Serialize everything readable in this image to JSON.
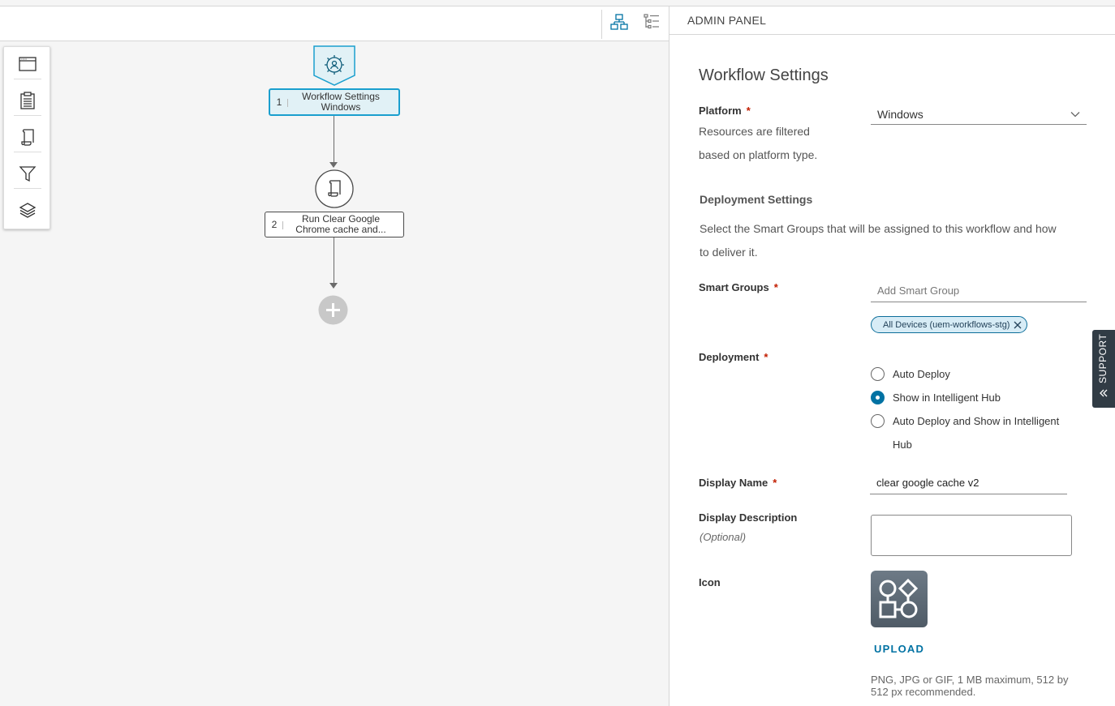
{
  "canvas": {
    "nodes": [
      {
        "number": "1",
        "line1": "Workflow Settings",
        "line2": "Windows"
      },
      {
        "number": "2",
        "line1": "Run Clear Google",
        "line2": "Chrome cache and..."
      }
    ]
  },
  "panel": {
    "header": "ADMIN PANEL",
    "title": "Workflow Settings",
    "platform": {
      "label": "Platform",
      "required": "*",
      "help_line1": "Resources are filtered",
      "help_line2": "based on platform type.",
      "value": "Windows"
    },
    "deployment_settings": {
      "title": "Deployment Settings",
      "desc_line1": "Select the Smart Groups that will be assigned to this workflow and how",
      "desc_line2": "to deliver it."
    },
    "smart_groups": {
      "label": "Smart Groups",
      "required": "*",
      "placeholder": "Add Smart Group",
      "chip": "All Devices (uem-workflows-stg)"
    },
    "deployment": {
      "label": "Deployment",
      "required": "*",
      "options": [
        "Auto Deploy",
        "Show in Intelligent Hub",
        "Auto Deploy and Show in Intelligent",
        "Hub"
      ],
      "selected": "Show in Intelligent Hub"
    },
    "display_name": {
      "label": "Display Name",
      "required": "*",
      "value": "clear google cache v2"
    },
    "display_description": {
      "label": "Display Description",
      "optional": "(Optional)",
      "value": ""
    },
    "icon": {
      "label": "Icon",
      "upload": "UPLOAD",
      "note_line1": "PNG, JPG or GIF, 1 MB maximum, 512 by",
      "note_line2": "512 px recommended."
    }
  },
  "support": {
    "label": "SUPPORT"
  },
  "colors": {
    "accent": "#0072a3",
    "selected_node": "#1a9fce",
    "required": "#c21d00"
  }
}
